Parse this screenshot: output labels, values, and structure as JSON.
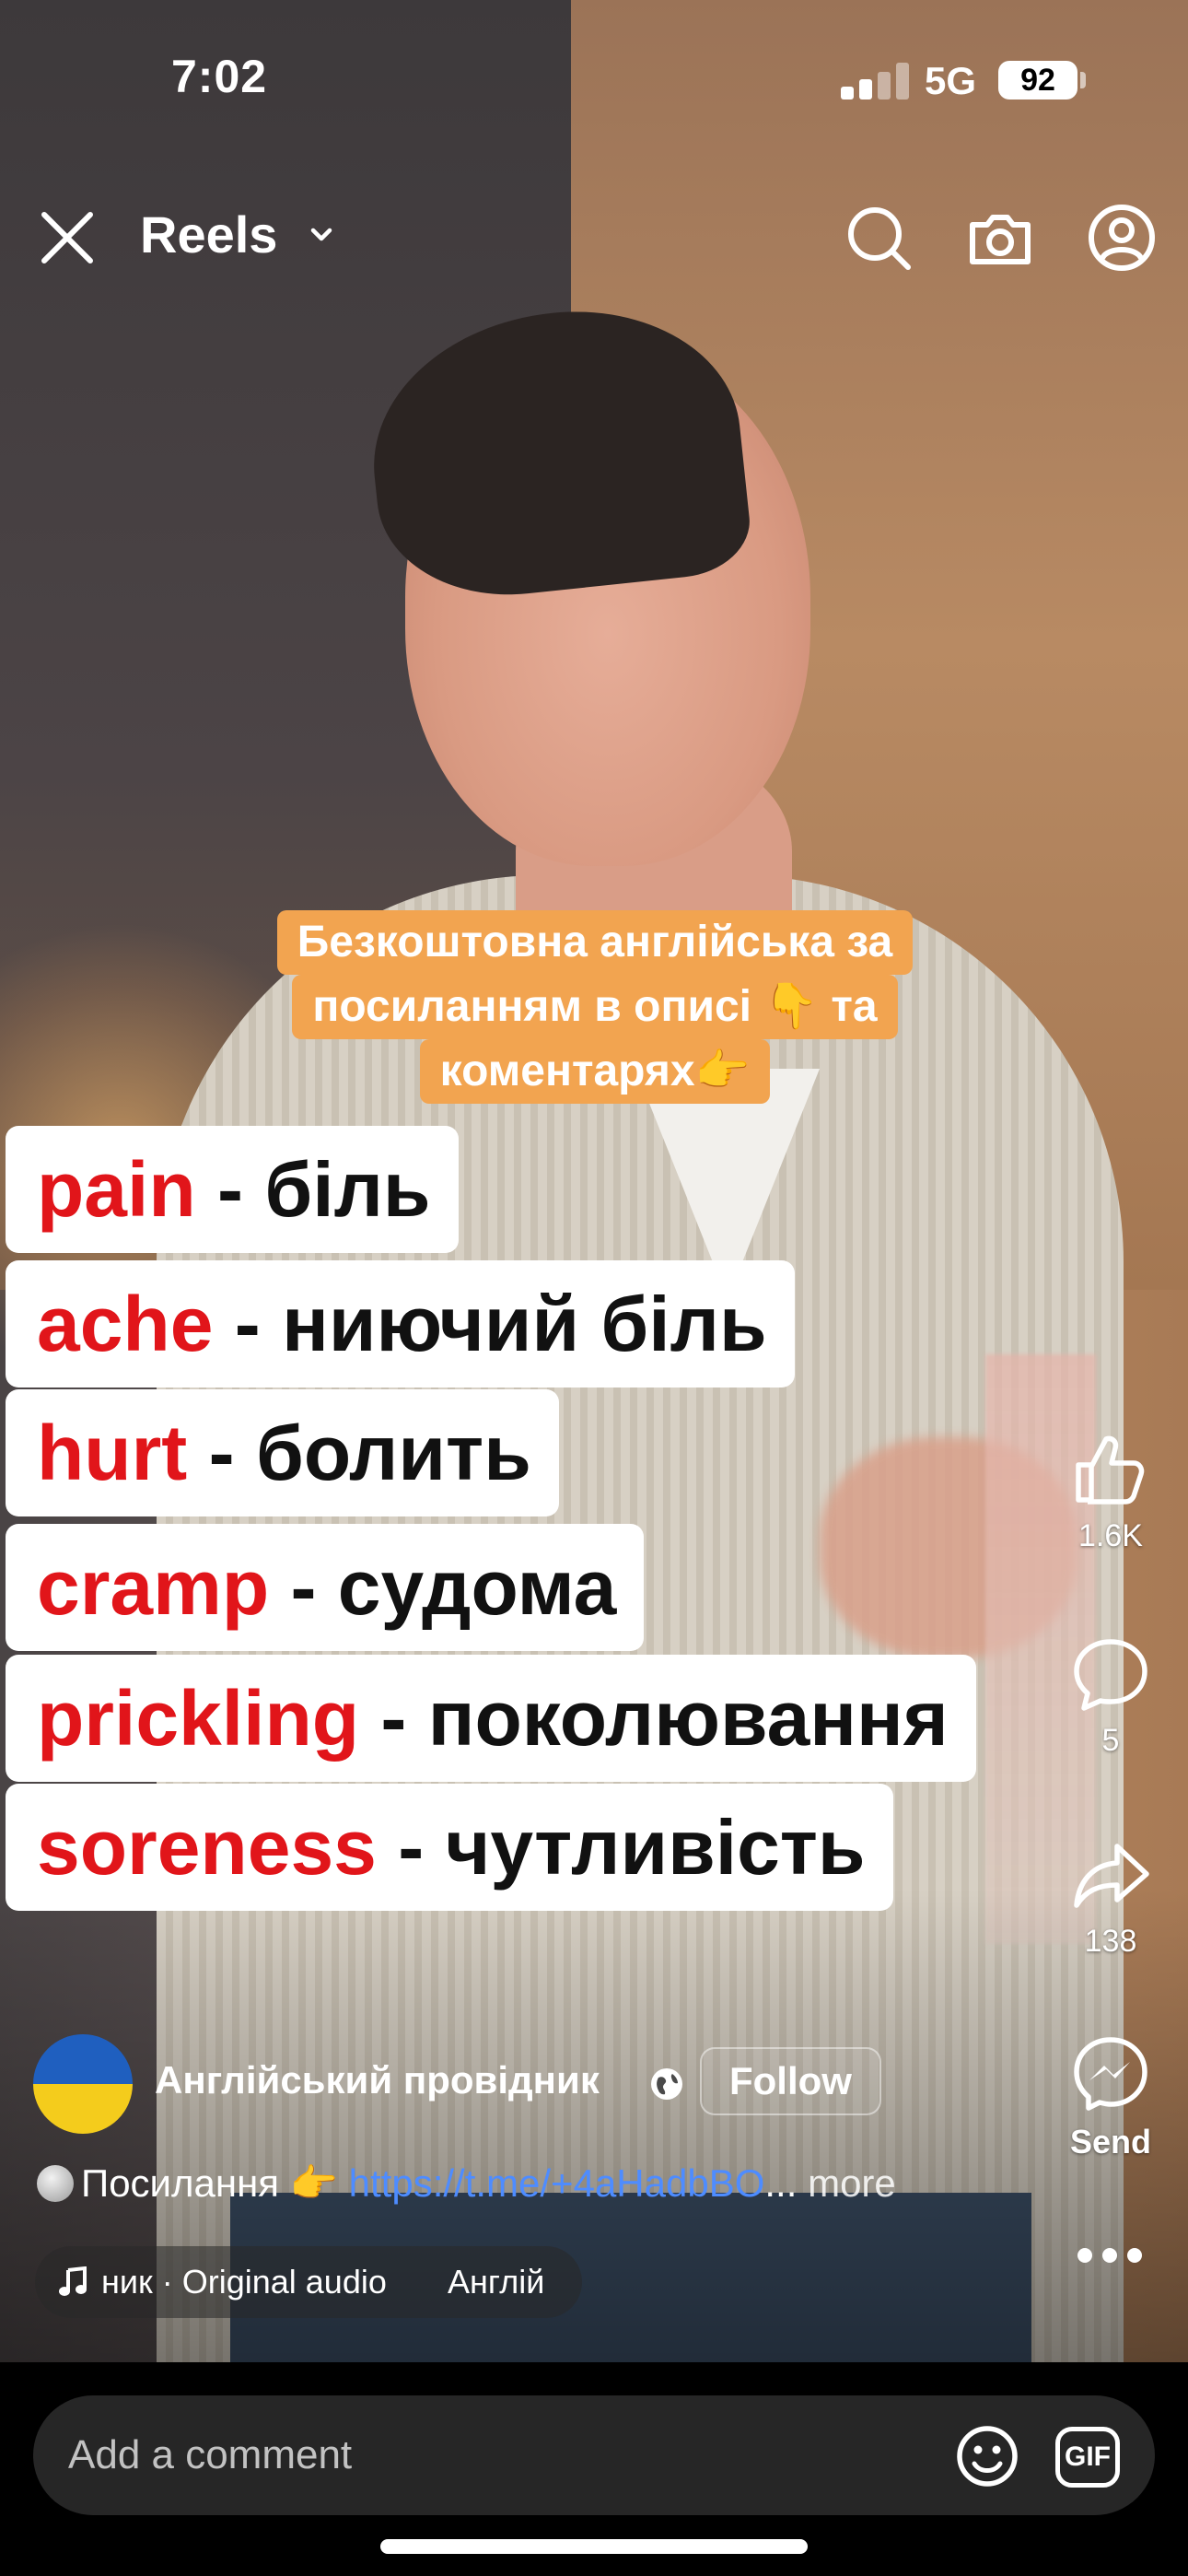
{
  "status_bar": {
    "time": "7:02",
    "network": "5G",
    "battery": "92"
  },
  "header": {
    "title": "Reels"
  },
  "promo": {
    "line1": "Безкоштовна англійська за",
    "line2": "посиланням в описі 👇 та",
    "line3": "коментарях👉"
  },
  "vocab": [
    {
      "en": "pain",
      "uk": "біль"
    },
    {
      "en": "ache",
      "uk": "ниючий біль"
    },
    {
      "en": "hurt",
      "uk": "болить"
    },
    {
      "en": "cramp",
      "uk": "судома"
    },
    {
      "en": "prickling",
      "uk": "поколювання"
    },
    {
      "en": "soreness",
      "uk": "чутливість"
    }
  ],
  "actions": {
    "likes": "1.6K",
    "comments": "5",
    "shares": "138",
    "send_label": "Send"
  },
  "author": {
    "name": "Англійський провідник",
    "follow_label": "Follow"
  },
  "caption": {
    "prefix": "Посилання 👉",
    "link": "https://t.me/+4aHadbBO",
    "ellipsis": "...",
    "more": "more"
  },
  "audio": {
    "text": "ник · Original audio",
    "text2": "Англій"
  },
  "comment": {
    "placeholder": "Add a comment",
    "gif_label": "GIF"
  },
  "colors": {
    "promo_bg": "#f2a450",
    "vocab_en": "#e1151a",
    "link": "#4e8cff",
    "comment_bg": "#262626"
  }
}
